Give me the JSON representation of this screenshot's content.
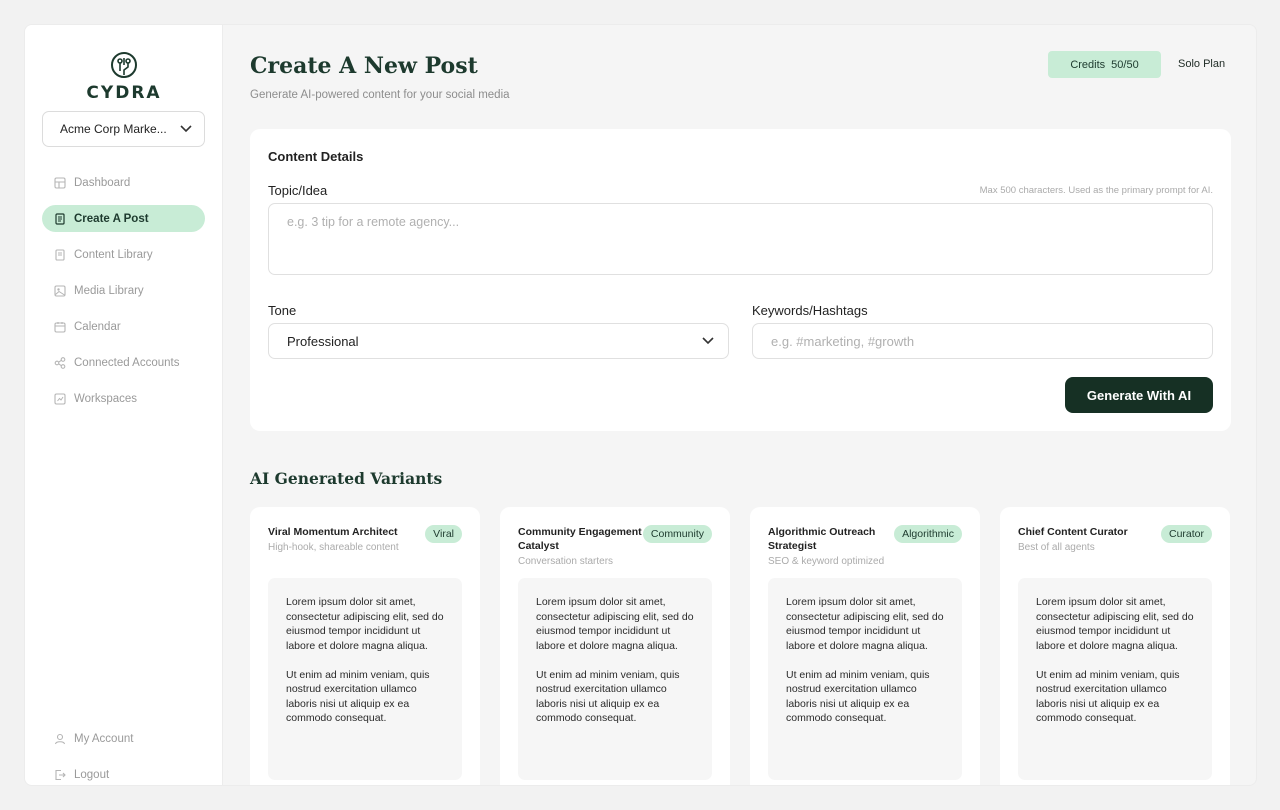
{
  "brand": {
    "name": "CYDRA"
  },
  "sidebar": {
    "workspace": "Acme Corp Marke...",
    "items": [
      {
        "label": "Dashboard",
        "icon": "dashboard-icon"
      },
      {
        "label": "Create A Post",
        "icon": "document-icon",
        "active": true
      },
      {
        "label": "Content Library",
        "icon": "library-icon"
      },
      {
        "label": "Media Library",
        "icon": "image-icon"
      },
      {
        "label": "Calendar",
        "icon": "calendar-icon"
      },
      {
        "label": "Connected Accounts",
        "icon": "share-icon"
      },
      {
        "label": "Workspaces",
        "icon": "workspace-icon"
      }
    ],
    "bottom": [
      {
        "label": "My Account",
        "icon": "user-icon"
      },
      {
        "label": "Logout",
        "icon": "logout-icon"
      }
    ]
  },
  "header": {
    "title": "Create A New Post",
    "subtitle": "Generate AI-powered content for your social media",
    "credits_label": "Credits",
    "credits_value": "50/50",
    "plan": "Solo Plan"
  },
  "form": {
    "title": "Content Details",
    "topic_label": "Topic/Idea",
    "topic_hint": "Max 500 characters. Used as the primary prompt for AI.",
    "topic_placeholder": "e.g. 3 tip for a remote agency...",
    "tone_label": "Tone",
    "tone_value": "Professional",
    "keywords_label": "Keywords/Hashtags",
    "keywords_placeholder": "e.g. #marketing, #growth",
    "generate_label": "Generate With AI"
  },
  "variants_title": "AI Generated Variants",
  "variants": [
    {
      "name": "Viral Momentum Architect",
      "subtitle": "High-hook, shareable content",
      "tag": "Viral",
      "p1": "Lorem ipsum dolor sit amet, consectetur adipiscing elit, sed do eiusmod tempor incididunt ut labore et dolore magna aliqua.",
      "p2": "Ut enim ad minim veniam, quis nostrud exercitation ullamco laboris nisi ut aliquip ex ea commodo consequat."
    },
    {
      "name": "Community Engagement Catalyst",
      "subtitle": "Conversation starters",
      "tag": "Community",
      "p1": "Lorem ipsum dolor sit amet, consectetur adipiscing elit, sed do eiusmod tempor incididunt ut labore et dolore magna aliqua.",
      "p2": "Ut enim ad minim veniam, quis nostrud exercitation ullamco laboris nisi ut aliquip ex ea commodo consequat."
    },
    {
      "name": "Algorithmic Outreach Strategist",
      "subtitle": "SEO & keyword optimized",
      "tag": "Algorithmic",
      "p1": "Lorem ipsum dolor sit amet, consectetur adipiscing elit, sed do eiusmod tempor incididunt ut labore et dolore magna aliqua.",
      "p2": "Ut enim ad minim veniam, quis nostrud exercitation ullamco laboris nisi ut aliquip ex ea commodo consequat."
    },
    {
      "name": "Chief Content Curator",
      "subtitle": "Best of all agents",
      "tag": "Curator",
      "p1": "Lorem ipsum dolor sit amet, consectetur adipiscing elit, sed do eiusmod tempor incididunt ut labore et dolore magna aliqua.",
      "p2": "Ut enim ad minim veniam, quis nostrud exercitation ullamco laboris nisi ut aliquip ex ea commodo consequat."
    }
  ]
}
